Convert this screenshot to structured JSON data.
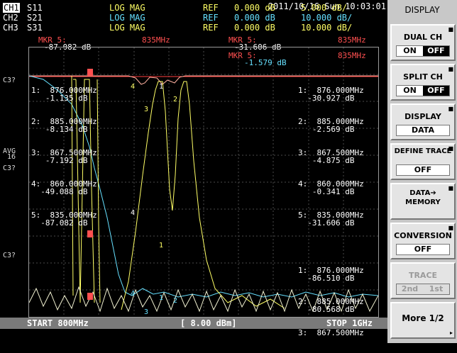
{
  "datetime": "2011/10/16 Sun 10:03:01",
  "channels": [
    {
      "ch": "CH1",
      "param": "S11",
      "format": "LOG MAG",
      "ref_label": "REF",
      "ref": "0.000 dB",
      "scale": "5.000 dB/",
      "active": true,
      "color": "#ffff66"
    },
    {
      "ch": "CH2",
      "param": "S21",
      "format": "LOG MAG",
      "ref_label": "REF",
      "ref": "0.000 dB",
      "scale": "10.000 dB/",
      "active": false,
      "color": "#66e0ff"
    },
    {
      "ch": "CH3",
      "param": "S31",
      "format": "LOG MAG",
      "ref_label": "REF",
      "ref": "0.000 dB",
      "scale": "10.000 dB/",
      "active": false,
      "color": "#ffff66"
    }
  ],
  "marker_headers": {
    "m1_label": "MKR 5:",
    "m1_freq": "835MHz",
    "m1_val": "-87.082 dB",
    "m2_label": "MKR 5:",
    "m2_freq": "835MHz",
    "m2_val": "-31.606 dB",
    "m3_label": "MKR 5:",
    "m3_freq": "835MHz",
    "m3_val": "-1.579 dB"
  },
  "left_labels": {
    "c3a": "C3?",
    "avg": "AVG",
    "avg_n": "16",
    "c3b": "C3?",
    "c3c": "C3?"
  },
  "marker_table_left": [
    "1:  876.000MHz",
    "   -1.135 dB",
    "2:  885.000MHz",
    "   -8.134 dB",
    "3:  867.500MHz",
    "   -7.192 dB",
    "4:  860.000MHz",
    "  -49.088 dB",
    "5:  835.000MHz",
    "  -87.082 dB"
  ],
  "marker_table_right_top": [
    "1:  876.000MHz",
    "  -30.927 dB",
    "2:  885.000MHz",
    "   -2.569 dB",
    "3:  867.500MHz",
    "   -4.875 dB",
    "4:  860.000MHz",
    "   -0.341 dB",
    "5:  835.000MHz",
    "  -31.606 dB"
  ],
  "marker_table_right_bottom": [
    "1:  876.000MHz",
    "  -86.510 dB",
    "2:  885.000MHz",
    "  -80.568 dB",
    "3:  867.500MHz"
  ],
  "status": {
    "start": "START 800MHz",
    "power": "[ 8.00 dBm]",
    "stop": "STOP 1GHz"
  },
  "softkeys": {
    "title": "DISPLAY",
    "dual_ch": {
      "label": "DUAL CH",
      "on": "ON",
      "off": "OFF"
    },
    "split_ch": {
      "label": "SPLIT CH",
      "on": "ON",
      "off": "OFF"
    },
    "display": {
      "label": "DISPLAY",
      "value": "DATA"
    },
    "define_trace": {
      "label": "DEFINE TRACE",
      "value": "OFF"
    },
    "data_memory": {
      "label": "DATA➔ MEMORY"
    },
    "conversion": {
      "label": "CONVERSION",
      "value": "OFF"
    },
    "trace": {
      "label": "TRACE",
      "opt1": "2nd",
      "opt2": "1st"
    },
    "more": {
      "label": "More 1/2"
    }
  },
  "colors": {
    "trace_yellow": "#ffff66",
    "trace_cyan": "#66e0ff",
    "trace_white": "#f0f0d0",
    "marker_red": "#ff5050",
    "ref_line": "#ff4040"
  }
}
